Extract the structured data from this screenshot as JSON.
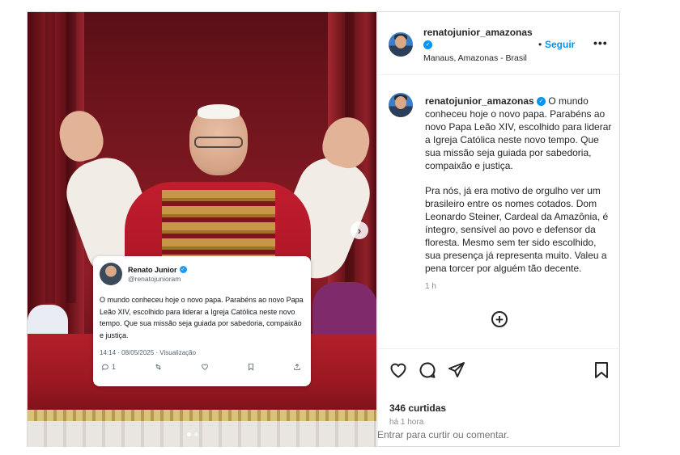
{
  "post": {
    "username": "renatojunior_amazonas",
    "follow_label": "Seguir",
    "bullet": "•",
    "more_label": "•••",
    "location": "Manaus, Amazonas - Brasil",
    "likes": "346 curtidas",
    "time_ago": "há 1 hora"
  },
  "caption": {
    "username": "renatojunior_amazonas",
    "paragraph1": "O mundo conheceu hoje o novo papa. Parabéns ao novo Papa Leão XIV, escolhido para liderar a Igreja Católica neste novo tempo. Que sua missão seja guiada por sabedoria, compaixão e justiça.",
    "paragraph2": "Pra nós, já era motivo de orgulho ver um brasileiro entre os nomes cotados. Dom Leonardo Steiner, Cardeal da Amazônia, é íntegro, sensível ao povo e defensor da floresta. Mesmo sem ter sido escolhido, sua presença já representa muito. Valeu a pena torcer por alguém tão decente.",
    "time": "1 h"
  },
  "tweet": {
    "name": "Renato Junior",
    "handle": "@renatojunioram",
    "text": "O mundo conheceu hoje o novo papa. Parabéns ao novo Papa Leão XIV, escolhido para liderar a Igreja Católica neste novo tempo. Que sua missão seja guiada por sabedoria, compaixão e justiça.",
    "meta": "14:14 · 08/05/2025 · Visualização",
    "reply_count": "1"
  },
  "comment_bar": {
    "enter_label": "Entrar",
    "rest": " para curtir ou comentar."
  },
  "icons": [
    "heart-icon",
    "comment-icon",
    "share-icon",
    "bookmark-icon",
    "add-circle-icon",
    "chevron-right-icon",
    "verified-icon"
  ],
  "colors": {
    "accent_blue": "#0095f6",
    "text": "#262626",
    "muted": "#8e8e8e",
    "border": "#dbdbdb"
  },
  "carousel": {
    "slides": 2,
    "active_index": 0
  }
}
